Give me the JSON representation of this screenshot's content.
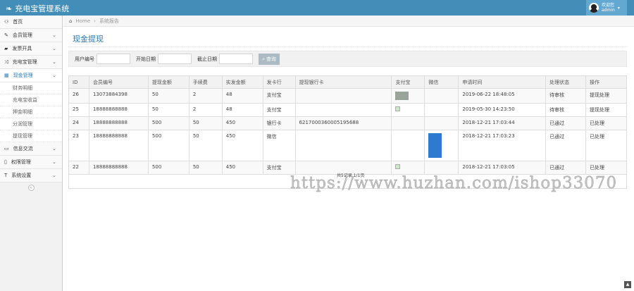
{
  "header": {
    "title": "充电宝管理系统",
    "welcome": "欢迎您",
    "username": "admin"
  },
  "sidebar": {
    "items": [
      {
        "label": "首页",
        "icon": "dashboard-icon"
      },
      {
        "label": "会员管理",
        "icon": "edit-icon"
      },
      {
        "label": "发票开具",
        "icon": "book-icon"
      },
      {
        "label": "充电宝管理",
        "icon": "random-icon"
      },
      {
        "label": "现金管理",
        "icon": "calendar-icon"
      }
    ],
    "subitems": [
      "财务明细",
      "充电宝收益",
      "押金明细",
      "分润管理",
      "提现管理"
    ],
    "items2": [
      {
        "label": "信息交流",
        "icon": "list-icon"
      },
      {
        "label": "权限管理",
        "icon": "file-icon"
      },
      {
        "label": "系统设置",
        "icon": "text-icon"
      }
    ]
  },
  "breadcrumb": {
    "home": "Home",
    "current": "系统报告"
  },
  "page_title": "现金提现",
  "filter": {
    "user_label": "用户编号",
    "start_label": "开始日期",
    "end_label": "截止日期",
    "search_label": "查询"
  },
  "table": {
    "headers": [
      "ID",
      "会员编号",
      "提现金额",
      "手续费",
      "实发金额",
      "发卡行",
      "提现银行卡",
      "支付宝",
      "微信",
      "申请时间",
      "处理状态",
      "操作"
    ],
    "rows": [
      {
        "id": "26",
        "member": "13073884398",
        "amount": "50",
        "fee": "2",
        "actual": "48",
        "bank": "支付宝",
        "card": "",
        "time": "2019-06-22 18:48:05",
        "status": "待审核",
        "action": "提现处理"
      },
      {
        "id": "25",
        "member": "18888888888",
        "amount": "50",
        "fee": "2",
        "actual": "48",
        "bank": "支付宝",
        "card": "",
        "time": "2019-05-30 14:23:50",
        "status": "待审核",
        "action": "提现处理"
      },
      {
        "id": "24",
        "member": "18888888888",
        "amount": "500",
        "fee": "50",
        "actual": "450",
        "bank": "银行卡",
        "card": "6217000360005195688",
        "time": "2018-12-21 17:03:44",
        "status": "已通过",
        "action": "已处理"
      },
      {
        "id": "23",
        "member": "18888888888",
        "amount": "500",
        "fee": "50",
        "actual": "450",
        "bank": "微信",
        "card": "",
        "time": "2018-12-21 17:03:23",
        "status": "已通过",
        "action": "已处理"
      },
      {
        "id": "22",
        "member": "18888888888",
        "amount": "500",
        "fee": "50",
        "actual": "450",
        "bank": "支付宝",
        "card": "",
        "time": "2018-12-21 17:03:05",
        "status": "已通过",
        "action": "已处理"
      }
    ]
  },
  "pager": "共5记录 1/1页",
  "watermark": "https://www.huzhan.com/ishop33070"
}
